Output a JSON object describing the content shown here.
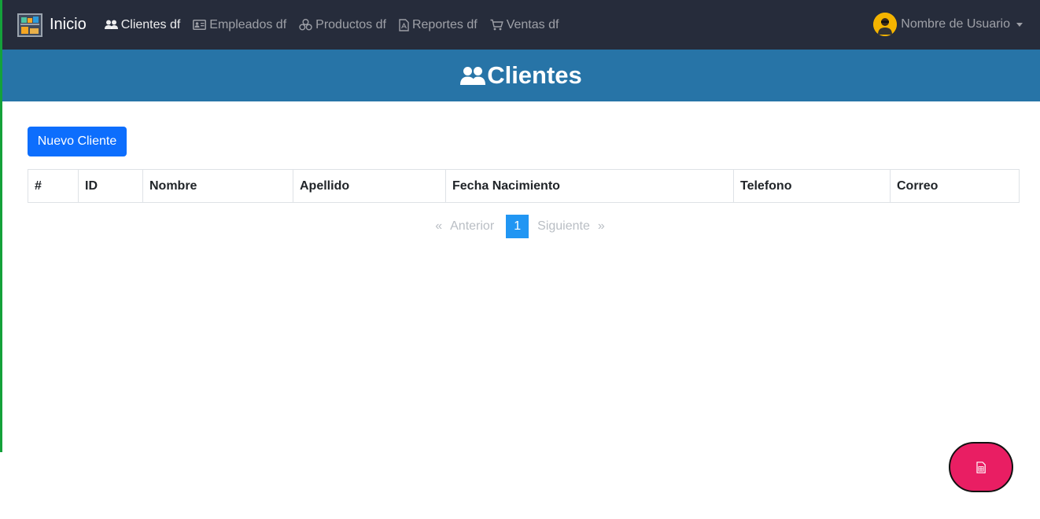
{
  "navbar": {
    "brand": "Inicio",
    "items": [
      {
        "label": "Clientes df",
        "icon": "users-icon",
        "active": true
      },
      {
        "label": "Empleados df",
        "icon": "id-card-icon"
      },
      {
        "label": "Productos df",
        "icon": "boxes-icon"
      },
      {
        "label": "Reportes df",
        "icon": "pdf-file-icon"
      },
      {
        "label": "Ventas df",
        "icon": "cart-icon"
      }
    ],
    "user": "Nombre de Usuario"
  },
  "header": {
    "title": "Clientes"
  },
  "main": {
    "new_button": "Nuevo Cliente",
    "table": {
      "headers": [
        "#",
        "ID",
        "Nombre",
        "Apellido",
        "Fecha Nacimiento",
        "Telefono",
        "Correo"
      ],
      "rows": []
    },
    "pagination": {
      "first": "«",
      "prev": "Anterior",
      "current": "1",
      "next": "Siguiente",
      "last": "»"
    }
  },
  "fab": {
    "icon": "spreadsheet-icon"
  },
  "colors": {
    "navbar": "#262c3b",
    "header": "#2774a7",
    "primary": "#0d6efd",
    "page_active": "#2196f3",
    "fab": "#e91e63"
  }
}
